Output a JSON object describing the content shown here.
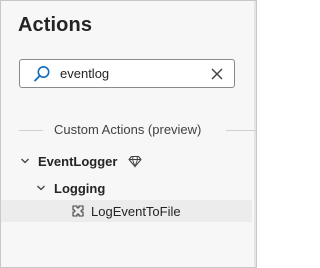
{
  "panel": {
    "title": "Actions"
  },
  "search": {
    "value": "eventlog",
    "icon": "search-icon",
    "clear_icon": "close-icon"
  },
  "section": {
    "label": "Custom Actions (preview)"
  },
  "tree": {
    "group": {
      "label": "EventLogger",
      "badge_icon": "premium-diamond-icon",
      "expanded": true
    },
    "subgroup": {
      "label": "Logging",
      "expanded": true
    },
    "action": {
      "label": "LogEventToFile",
      "icon": "custom-action-icon"
    }
  },
  "colors": {
    "accent": "#0f6cbd",
    "text": "#242424",
    "panel_bg": "#f7f7f7",
    "hover_row": "#ececec"
  }
}
